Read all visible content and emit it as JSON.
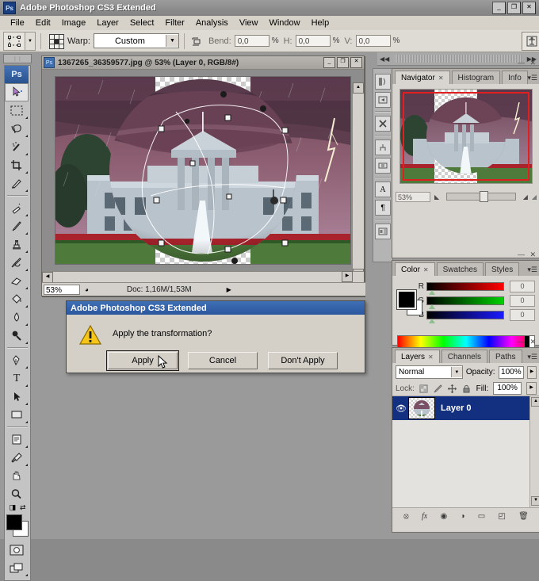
{
  "app": {
    "title": "Adobe Photoshop CS3 Extended",
    "logo": "Ps",
    "window_buttons": [
      {
        "name": "minimize",
        "glyph": "_"
      },
      {
        "name": "maximize",
        "glyph": "❐"
      },
      {
        "name": "close",
        "glyph": "✕"
      }
    ]
  },
  "menubar": {
    "items": [
      {
        "label": "File"
      },
      {
        "label": "Edit"
      },
      {
        "label": "Image"
      },
      {
        "label": "Layer"
      },
      {
        "label": "Select"
      },
      {
        "label": "Filter"
      },
      {
        "label": "Analysis"
      },
      {
        "label": "View"
      },
      {
        "label": "Window"
      },
      {
        "label": "Help"
      }
    ]
  },
  "options_bar": {
    "tool_icon": "free-transform-icon",
    "warp_label": "Warp:",
    "warp_value": "Custom",
    "bend_label": "Bend:",
    "bend_value": "0,0",
    "h_label": "H:",
    "h_value": "0,0",
    "v_label": "V:",
    "v_value": "0,0",
    "percent": "%",
    "right_icon": "toggle-warp-mode-icon"
  },
  "toolbox": {
    "logo": "Ps",
    "tools": [
      {
        "name": "move-tool",
        "active": true
      },
      {
        "name": "rectangular-marquee-tool",
        "active": false
      },
      {
        "name": "lasso-tool",
        "active": false
      },
      {
        "name": "magic-wand-tool",
        "active": false
      },
      {
        "name": "crop-tool",
        "active": false
      },
      {
        "name": "slice-tool",
        "active": false
      },
      {
        "name": "healing-brush-tool",
        "active": false
      },
      {
        "name": "brush-tool",
        "active": false
      },
      {
        "name": "clone-stamp-tool",
        "active": false
      },
      {
        "name": "history-brush-tool",
        "active": false
      },
      {
        "name": "eraser-tool",
        "active": false
      },
      {
        "name": "paint-bucket-tool",
        "active": false
      },
      {
        "name": "blur-tool",
        "active": false
      },
      {
        "name": "dodge-tool",
        "active": false
      },
      {
        "name": "pen-tool",
        "active": false
      },
      {
        "name": "type-tool",
        "active": false
      },
      {
        "name": "path-selection-tool",
        "active": false
      },
      {
        "name": "rectangle-shape-tool",
        "active": false
      },
      {
        "name": "notes-tool",
        "active": false
      },
      {
        "name": "eyedropper-tool",
        "active": false
      },
      {
        "name": "hand-tool",
        "active": false
      },
      {
        "name": "zoom-tool",
        "active": false
      }
    ],
    "foreground_color": "#000000",
    "background_color": "#ffffff",
    "quick_mask": "quick-mask-icon",
    "screen_mode": "screen-mode-icon"
  },
  "document": {
    "title": "1367265_36359577.jpg @ 53% (Layer 0, RGB/8#)",
    "zoom": "53%",
    "doc_info": "Doc: 1,16M/1,53M",
    "window_buttons": [
      {
        "name": "minimize",
        "glyph": "_"
      },
      {
        "name": "maximize",
        "glyph": "❐"
      },
      {
        "name": "close",
        "glyph": "✕"
      }
    ]
  },
  "mini_dock": {
    "buttons": [
      {
        "name": "brushes-panel-icon"
      },
      {
        "name": "tool-presets-panel-icon"
      },
      {
        "name": "tool-options-panel-icon"
      },
      {
        "name": "clone-source-panel-icon"
      },
      {
        "name": "animation-panel-icon"
      },
      {
        "name": "character-panel-icon"
      },
      {
        "name": "paragraph-panel-icon"
      },
      {
        "name": "layer-comps-panel-icon"
      }
    ]
  },
  "dock": {
    "collapse_left": "◀◀",
    "collapse_right": "▶▶"
  },
  "navigator_panel": {
    "tabs": [
      {
        "label": "Navigator",
        "active": true,
        "closable": true
      },
      {
        "label": "Histogram",
        "active": false,
        "closable": false
      },
      {
        "label": "Info",
        "active": false,
        "closable": false
      }
    ],
    "zoom_value": "53%",
    "zoom_out_icon": "zoom-out-icon",
    "zoom_in_icon": "zoom-in-icon",
    "view_box_color": "#e02020"
  },
  "color_panel": {
    "tabs": [
      {
        "label": "Color",
        "active": true,
        "closable": true
      },
      {
        "label": "Swatches",
        "active": false,
        "closable": false
      },
      {
        "label": "Styles",
        "active": false,
        "closable": false
      }
    ],
    "channels": [
      {
        "label": "R",
        "value": "0"
      },
      {
        "label": "G",
        "value": "0"
      },
      {
        "label": "B",
        "value": "0"
      }
    ],
    "foreground_color": "#000000",
    "background_color": "#ffffff"
  },
  "layers_panel": {
    "tabs": [
      {
        "label": "Layers",
        "active": true,
        "closable": true
      },
      {
        "label": "Channels",
        "active": false,
        "closable": false
      },
      {
        "label": "Paths",
        "active": false,
        "closable": false
      }
    ],
    "blend_mode": "Normal",
    "opacity_label": "Opacity:",
    "opacity_value": "100%",
    "lock_label": "Lock:",
    "lock_icons": [
      {
        "name": "lock-transparent-pixels-icon"
      },
      {
        "name": "lock-image-pixels-icon"
      },
      {
        "name": "lock-position-icon"
      },
      {
        "name": "lock-all-icon"
      }
    ],
    "fill_label": "Fill:",
    "fill_value": "100%",
    "layers": [
      {
        "name": "Layer 0",
        "visible": true,
        "selected": true
      }
    ],
    "footer_icons": [
      {
        "name": "link-layers-icon",
        "glyph": "⦻"
      },
      {
        "name": "layer-style-icon",
        "glyph": "fx"
      },
      {
        "name": "layer-mask-icon",
        "glyph": "◉"
      },
      {
        "name": "adjustment-layer-icon",
        "glyph": "◑"
      },
      {
        "name": "new-group-icon",
        "glyph": "▭"
      },
      {
        "name": "new-layer-icon",
        "glyph": "◰"
      },
      {
        "name": "delete-layer-icon",
        "glyph": "🗑"
      }
    ]
  },
  "dialog": {
    "title": "Adobe Photoshop CS3 Extended",
    "icon": "warning-icon",
    "message": "Apply the transformation?",
    "buttons": [
      {
        "label": "Apply",
        "name": "apply-button",
        "default": true
      },
      {
        "label": "Cancel",
        "name": "cancel-button",
        "default": false
      },
      {
        "label": "Don't Apply",
        "name": "dont-apply-button",
        "default": false
      }
    ]
  }
}
